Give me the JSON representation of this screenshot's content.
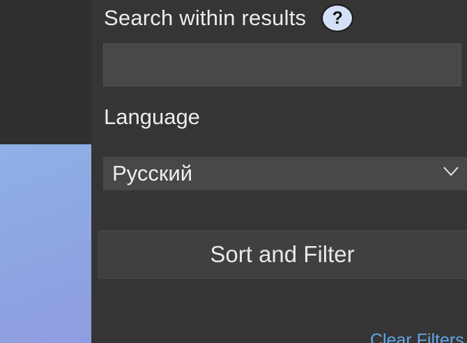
{
  "search": {
    "label": "Search within results",
    "help_glyph": "?",
    "value": "",
    "placeholder": ""
  },
  "language": {
    "label": "Language",
    "selected": "Русский"
  },
  "actions": {
    "sort_filter_label": "Sort and Filter",
    "clear_filters_label": "Clear Filters"
  },
  "icons": {
    "help": "question-mark-icon",
    "dropdown": "chevron-down-icon"
  },
  "colors": {
    "panel_bg": "#353535",
    "input_bg": "#484848",
    "link": "#62a6e8",
    "help_bg": "#d3e0f6",
    "side_gradient_start": "#8fb0e6",
    "side_gradient_end": "#8f9de0"
  }
}
